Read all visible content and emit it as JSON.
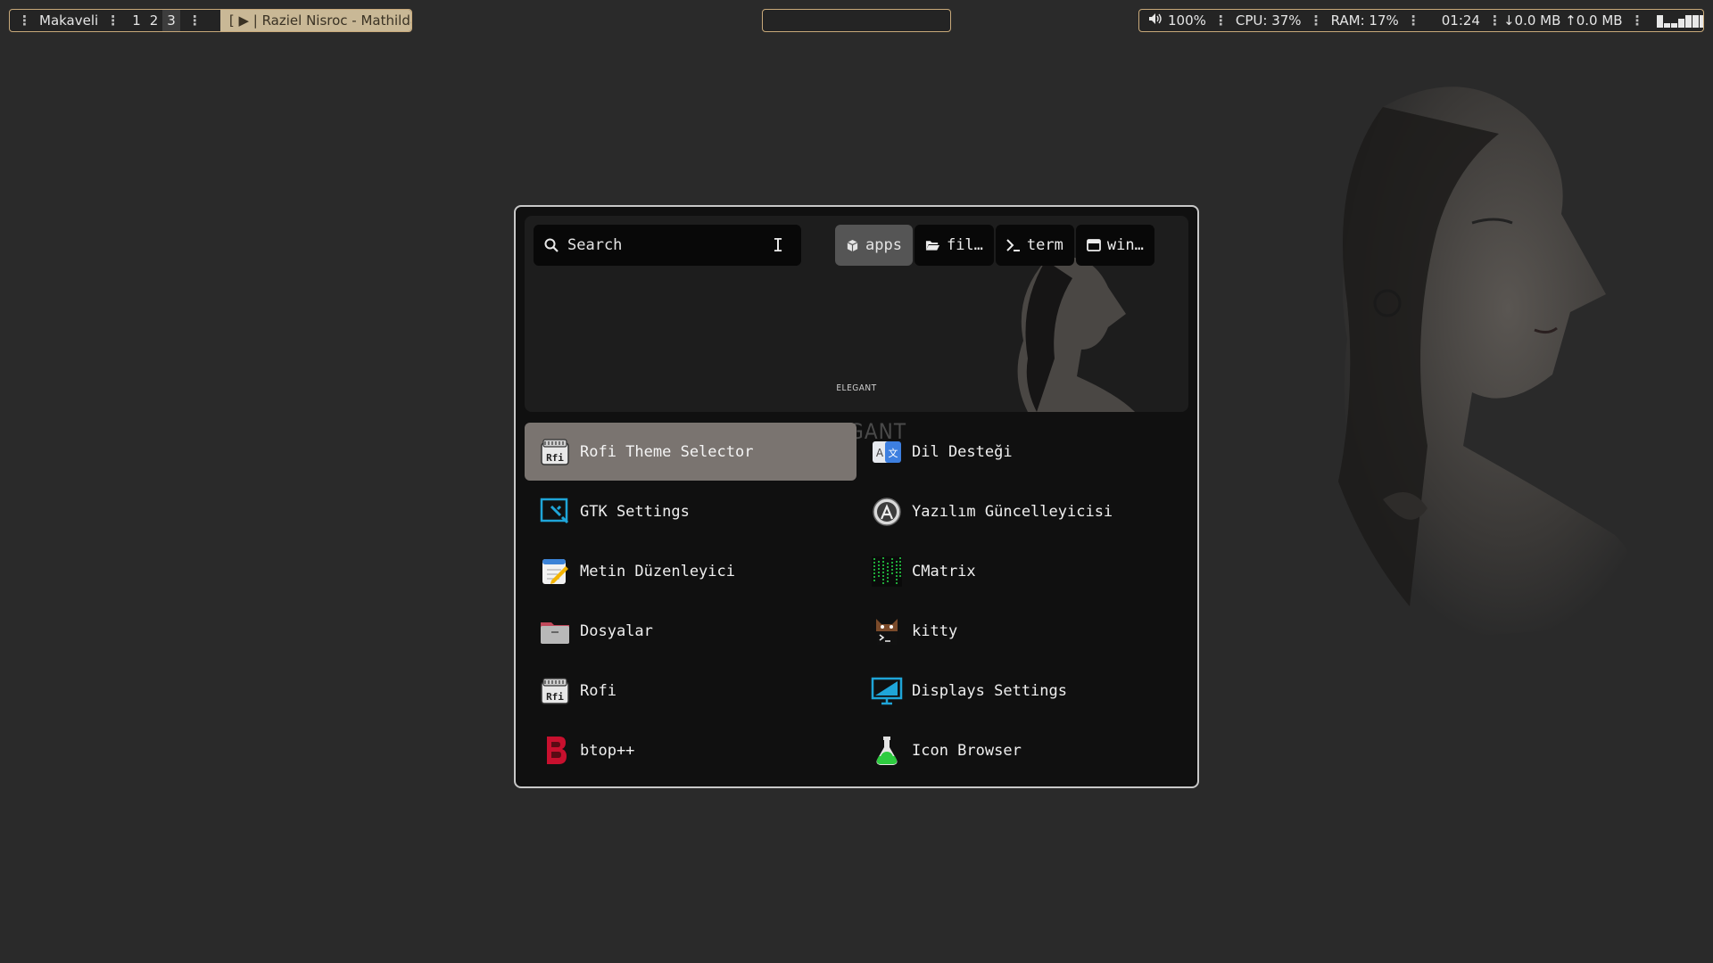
{
  "topbar": {
    "left": {
      "host": "Makaveli",
      "workspaces": [
        "1",
        "2",
        "3"
      ],
      "active_workspace": 2,
      "now_playing": "[ ▶ | Raziel Nisroc - Mathilda ]"
    },
    "center": {
      "title": ""
    },
    "right": {
      "volume": "100%",
      "cpu": "CPU: 37%",
      "ram": "RAM: 17%",
      "clock": "01:24",
      "network": "↓0.0 MB ↑0.0 MB",
      "graph_levels": [
        0.9,
        0.3,
        0.3,
        0.6,
        0.9,
        0.9,
        0.9
      ]
    },
    "accent_color": "#c8a97a"
  },
  "launcher": {
    "banner_text": "ELEGANT",
    "watermark_text": "ELEGANT",
    "search": {
      "placeholder": "Search"
    },
    "modes": [
      {
        "label": "apps",
        "icon": "cube-icon",
        "active": true
      },
      {
        "label": "fil…",
        "icon": "folder-open-icon",
        "active": false
      },
      {
        "label": "term",
        "icon": "terminal-prompt-icon",
        "active": false
      },
      {
        "label": "win…",
        "icon": "window-icon",
        "active": false
      }
    ],
    "items": [
      {
        "label": "Rofi Theme Selector",
        "icon": "rofi-icon",
        "selected": true
      },
      {
        "label": "Dil Desteği",
        "icon": "language-translate-icon",
        "selected": false
      },
      {
        "label": "GTK Settings",
        "icon": "gtk-settings-icon",
        "selected": false
      },
      {
        "label": "Yazılım Güncelleyicisi",
        "icon": "software-updater-icon",
        "selected": false
      },
      {
        "label": "Metin Düzenleyici",
        "icon": "text-editor-icon",
        "selected": false
      },
      {
        "label": "CMatrix",
        "icon": "cmatrix-icon",
        "selected": false
      },
      {
        "label": "Dosyalar",
        "icon": "folder-icon",
        "selected": false
      },
      {
        "label": "kitty",
        "icon": "kitty-icon",
        "selected": false
      },
      {
        "label": "Rofi",
        "icon": "rofi-icon",
        "selected": false
      },
      {
        "label": "Displays Settings",
        "icon": "display-monitor-icon",
        "selected": false
      },
      {
        "label": "btop++",
        "icon": "btop-icon",
        "selected": false
      },
      {
        "label": "Icon Browser",
        "icon": "flask-icon",
        "selected": false
      }
    ],
    "selection_color": "#7a7470"
  }
}
